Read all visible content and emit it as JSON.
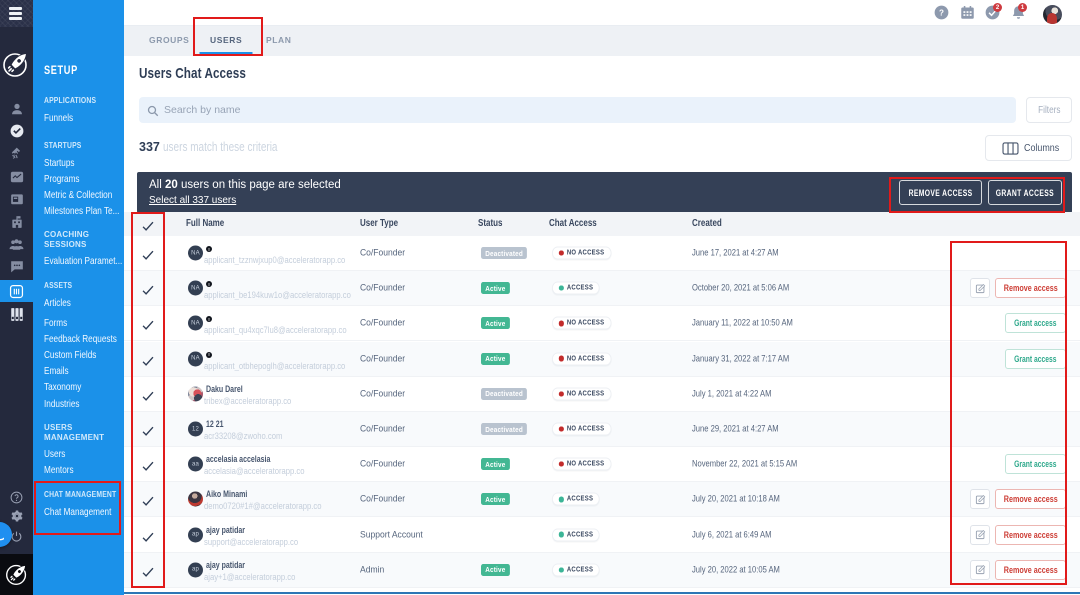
{
  "colors": {
    "sidebar_blue": "#1b91e9",
    "rail_dark": "#262b40",
    "banner_navy": "#344056",
    "active_green": "#43b793",
    "deactivated_gray": "#b9c3cf",
    "no_access_red": "#c22b2b",
    "access_green": "#3cb597",
    "annotation_red": "#e11a1a"
  },
  "rail": {
    "icons": [
      "menu",
      "rocket-logo",
      "profile",
      "check-circle",
      "satellite",
      "chart",
      "briefcase",
      "building",
      "team",
      "chat-bubble",
      "chat-settings-active",
      "columns-bars",
      "help",
      "settings",
      "power",
      "chat-launcher",
      "footer-rocket-logo"
    ]
  },
  "sidebar": {
    "title": "SETUP",
    "sections": [
      {
        "header": "APPLICATIONS",
        "items": [
          "Funnels"
        ]
      },
      {
        "header": "STARTUPS",
        "items": [
          "Startups",
          "Programs",
          "Metric & Collection",
          "Milestones Plan Te..."
        ]
      },
      {
        "header": "COACHING SESSIONS",
        "items": [
          "Evaluation Paramet..."
        ]
      },
      {
        "header": "ASSETS",
        "items": [
          "Articles",
          "Forms",
          "Feedback Requests",
          "Custom Fields",
          "Emails",
          "Taxonomy",
          "Industries"
        ]
      },
      {
        "header": "USERS MANAGEMENT",
        "items": [
          "Users",
          "Mentors"
        ]
      },
      {
        "header": "CHAT MANAGEMENT",
        "items": [
          "Chat Management"
        ]
      }
    ]
  },
  "topbar": {
    "tasks_badge": "2",
    "notifications_badge": "1"
  },
  "tabs": [
    {
      "label": "GROUPS",
      "active": false
    },
    {
      "label": "USERS",
      "active": true
    },
    {
      "label": "PLAN",
      "active": false
    }
  ],
  "page": {
    "title": "Users Chat Access"
  },
  "search": {
    "placeholder": "Search by name",
    "filters_label": "Filters"
  },
  "results": {
    "count": "337",
    "text": "users match these criteria",
    "columns_label": "Columns"
  },
  "selection_banner": {
    "prefix": "All",
    "count": "20",
    "suffix": "users on this page are selected",
    "select_all": "Select all 337 users",
    "remove_label": "REMOVE ACCESS",
    "grant_label": "GRANT ACCESS"
  },
  "table": {
    "columns": [
      "Full Name",
      "User Type",
      "Status",
      "Chat Access",
      "Created"
    ],
    "rows": [
      {
        "initials": "NA",
        "name": "",
        "email": "applicant_tzznwjxup0@acceleratorapp.co",
        "user_type": "Co/Founder",
        "status": "Deactivated",
        "chat_access": "NO ACCESS",
        "created": "June 17, 2021 at 4:27 AM",
        "action": ""
      },
      {
        "initials": "NA",
        "name": "",
        "email": "applicant_be194kuw1o@acceleratorapp.co",
        "user_type": "Co/Founder",
        "status": "Active",
        "chat_access": "ACCESS",
        "created": "October 20, 2021 at 5:06 AM",
        "action": "Remove access"
      },
      {
        "initials": "NA",
        "name": "",
        "email": "applicant_qu4xqc7lu8@acceleratorapp.co",
        "user_type": "Co/Founder",
        "status": "Active",
        "chat_access": "NO ACCESS",
        "created": "January 11, 2022 at 10:50 AM",
        "action": "Grant access"
      },
      {
        "initials": "NA",
        "name": "",
        "email": "applicant_otbhepoglh@acceleratorapp.co",
        "user_type": "Co/Founder",
        "status": "Active",
        "chat_access": "NO ACCESS",
        "created": "January 31, 2022 at 7:17 AM",
        "action": "Grant access"
      },
      {
        "initials": "",
        "name": "Daku Darel",
        "email": "tribex@acceleratorapp.co",
        "user_type": "Co/Founder",
        "status": "Deactivated",
        "chat_access": "NO ACCESS",
        "created": "July 1, 2021 at 4:22 AM",
        "action": ""
      },
      {
        "initials": "12",
        "name": "12 21",
        "email": "acr33208@zwoho.com",
        "user_type": "Co/Founder",
        "status": "Deactivated",
        "chat_access": "NO ACCESS",
        "created": "June 29, 2021 at 4:27 AM",
        "action": ""
      },
      {
        "initials": "aa",
        "name": "accelasia accelasia",
        "email": "accelasia@acceleratorapp.co",
        "user_type": "Co/Founder",
        "status": "Active",
        "chat_access": "NO ACCESS",
        "created": "November 22, 2021 at 5:15 AM",
        "action": "Grant access"
      },
      {
        "initials": "",
        "name": "Aiko Minami",
        "email": "demo0720#1#@acceleratorapp.co",
        "user_type": "Co/Founder",
        "status": "Active",
        "chat_access": "ACCESS",
        "created": "July 20, 2021 at 10:18 AM",
        "action": "Remove access"
      },
      {
        "initials": "ap",
        "name": "ajay patidar",
        "email": "support@acceleratorapp.co",
        "user_type": "Support Account",
        "status": "",
        "chat_access": "ACCESS",
        "created": "July 6, 2021 at 6:49 AM",
        "action": "Remove access"
      },
      {
        "initials": "ap",
        "name": "ajay patidar",
        "email": "ajay+1@acceleratorapp.co",
        "user_type": "Admin",
        "status": "Active",
        "chat_access": "ACCESS",
        "created": "July 20, 2022 at 10:05 AM",
        "action": "Remove access"
      }
    ]
  }
}
